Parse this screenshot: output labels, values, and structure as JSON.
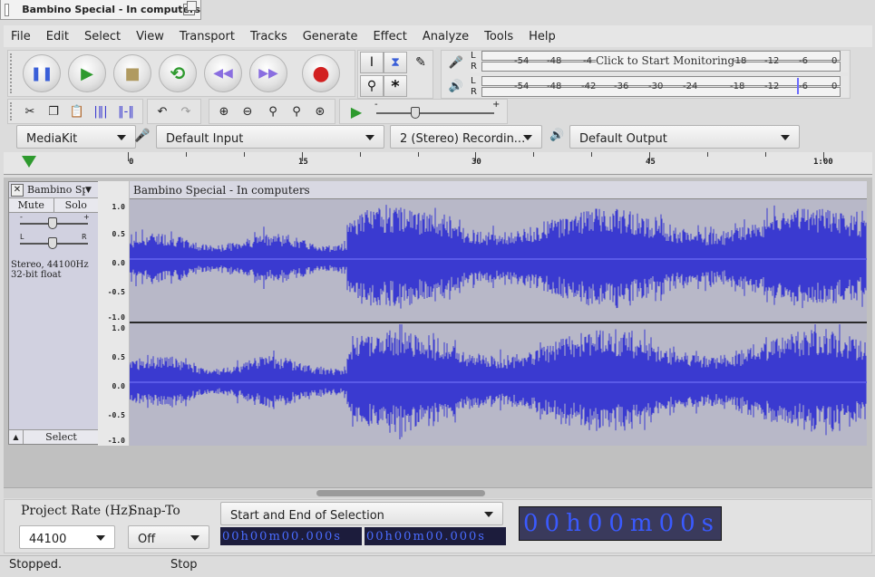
{
  "window": {
    "title": "Bambino Special - In computers"
  },
  "menu": [
    "File",
    "Edit",
    "Select",
    "View",
    "Transport",
    "Tracks",
    "Generate",
    "Effect",
    "Analyze",
    "Tools",
    "Help"
  ],
  "transport": {
    "buttons": [
      {
        "name": "pause",
        "icon": "⏸",
        "color": "#3a5fd8"
      },
      {
        "name": "play",
        "icon": "▶",
        "color": "#2e9a2e"
      },
      {
        "name": "stop",
        "icon": "■",
        "color": "#b09a60"
      },
      {
        "name": "loop",
        "icon": "⟲",
        "color": "#2e9a2e"
      },
      {
        "name": "skip-start",
        "icon": "⏮",
        "color": "#8a6ee0"
      },
      {
        "name": "skip-end",
        "icon": "⏭",
        "color": "#8a6ee0"
      },
      {
        "name": "record",
        "icon": "●",
        "color": "#d22020"
      }
    ]
  },
  "meters": {
    "record": {
      "ticks": [
        "-54",
        "-48",
        "-4",
        "Click to Start Monitoring",
        "-18",
        "-12",
        "-6",
        "0"
      ]
    },
    "playback": {
      "ticks": [
        "-54",
        "-48",
        "-42",
        "-36",
        "-30",
        "-24",
        "-18",
        "-12",
        "-6",
        "0"
      ]
    },
    "channels": [
      "L",
      "R"
    ]
  },
  "devices": {
    "host": "MediaKit",
    "input": "Default Input",
    "channels": "2 (Stereo) Recordin...",
    "output": "Default Output"
  },
  "ruler": {
    "labels": [
      "0",
      "15",
      "30",
      "45",
      "1:00"
    ]
  },
  "track": {
    "name": "Bambino Sp",
    "clip_name": "Bambino Special - In computers",
    "mute": "Mute",
    "solo": "Solo",
    "gain_minus": "-",
    "gain_plus": "+",
    "pan_left": "L",
    "pan_right": "R",
    "info_line1": "Stereo, 44100Hz",
    "info_line2": "32-bit float",
    "select": "Select",
    "close": "✕",
    "scale": [
      "1.0",
      "0.5",
      "0.0",
      "-0.5",
      "-1.0"
    ],
    "wave_color": "#3a3ad0",
    "wave_bg": "#b8b8c8"
  },
  "selection": {
    "project_rate_label": "Project Rate (Hz)",
    "project_rate": "44100",
    "snap_label": "Snap-To",
    "snap_value": "Off",
    "mode": "Start and End of Selection",
    "start": "00h00m00.000s",
    "end": "00h00m00.000s",
    "big_time": "00h00m00s"
  },
  "status": {
    "left": "Stopped.",
    "right": "Stop"
  }
}
